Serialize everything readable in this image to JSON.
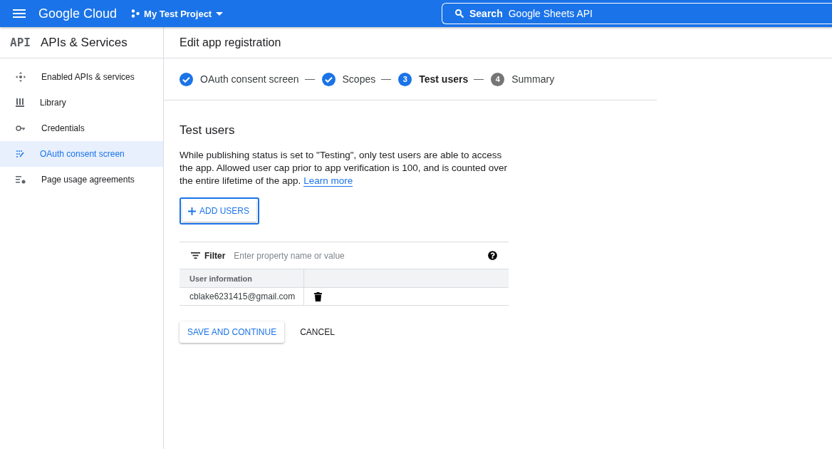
{
  "topbar": {
    "brand": "Google Cloud",
    "project": "My Test Project",
    "search": {
      "label": "Search",
      "value": "Google Sheets API"
    }
  },
  "sidebar": {
    "badge": "API",
    "title": "APIs & Services",
    "items": [
      {
        "label": "Enabled APIs & services",
        "selected": false
      },
      {
        "label": "Library",
        "selected": false
      },
      {
        "label": "Credentials",
        "selected": false
      },
      {
        "label": "OAuth consent screen",
        "selected": true
      },
      {
        "label": "Page usage agreements",
        "selected": false
      }
    ]
  },
  "page_title": "Edit app registration",
  "stepper": [
    {
      "label": "OAuth consent screen",
      "kind": "done"
    },
    {
      "label": "Scopes",
      "kind": "done"
    },
    {
      "number": "3",
      "label": "Test users",
      "kind": "current"
    },
    {
      "number": "4",
      "label": "Summary",
      "kind": "pending"
    }
  ],
  "section": {
    "title": "Test users",
    "description": "While publishing status is set to \"Testing\", only test users are able to access the app. Allowed user cap prior to app verification is 100, and is counted over the entire lifetime of the app.",
    "link": "Learn more"
  },
  "add_button": "ADD USERS",
  "filter": {
    "label": "Filter",
    "placeholder": "Enter property name or value"
  },
  "table": {
    "columns": [
      "User information"
    ],
    "rows": [
      {
        "email": "cblake6231415@gmail.com"
      }
    ]
  },
  "buttons": {
    "primary": "SAVE AND CONTINUE",
    "secondary": "CANCEL"
  }
}
